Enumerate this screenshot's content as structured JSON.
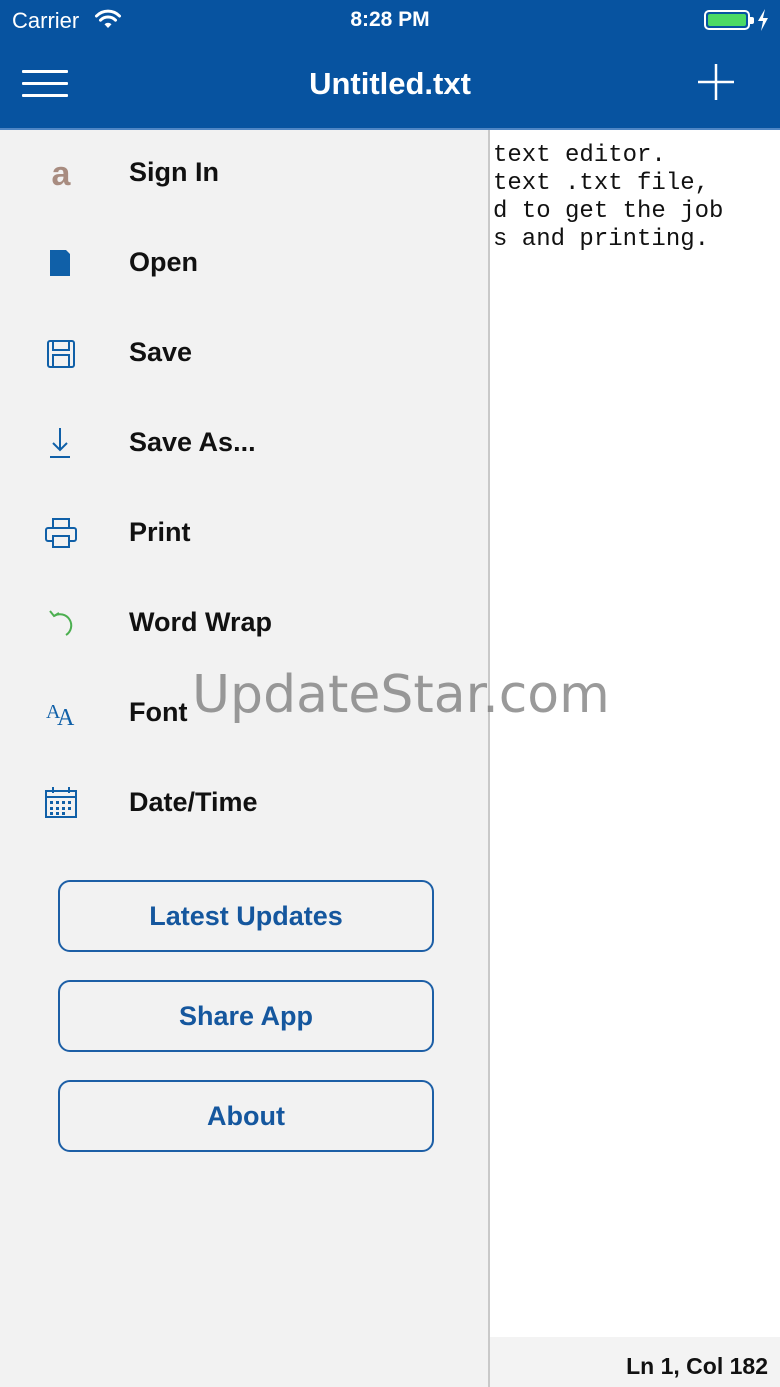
{
  "status_bar": {
    "carrier": "Carrier",
    "time": "8:28 PM",
    "battery_color": "#4cd964"
  },
  "nav": {
    "title": "Untitled.txt",
    "menu_icon": "hamburger-icon",
    "add_icon": "plus-icon",
    "bar_color": "#0753a0"
  },
  "drawer": {
    "items": [
      {
        "label": "Sign In",
        "icon": "amazon-a-icon"
      },
      {
        "label": "Open",
        "icon": "folder-icon"
      },
      {
        "label": "Save",
        "icon": "floppy-disk-icon"
      },
      {
        "label": "Save As...",
        "icon": "download-arrow-icon"
      },
      {
        "label": "Print",
        "icon": "printer-icon"
      },
      {
        "label": "Word Wrap",
        "icon": "wrap-arrow-icon"
      },
      {
        "label": "Font",
        "icon": "font-size-icon"
      },
      {
        "label": "Date/Time",
        "icon": "calendar-icon"
      }
    ],
    "buttons": [
      {
        "label": "Latest Updates"
      },
      {
        "label": "Share App"
      },
      {
        "label": "About"
      }
    ]
  },
  "editor": {
    "text": "text editor.\ntext .txt file,\nd to get the job\ns and printing."
  },
  "footer": {
    "cursor_position": "Ln 1, Col 182"
  },
  "watermark": {
    "text": "UpdateStar.com"
  }
}
